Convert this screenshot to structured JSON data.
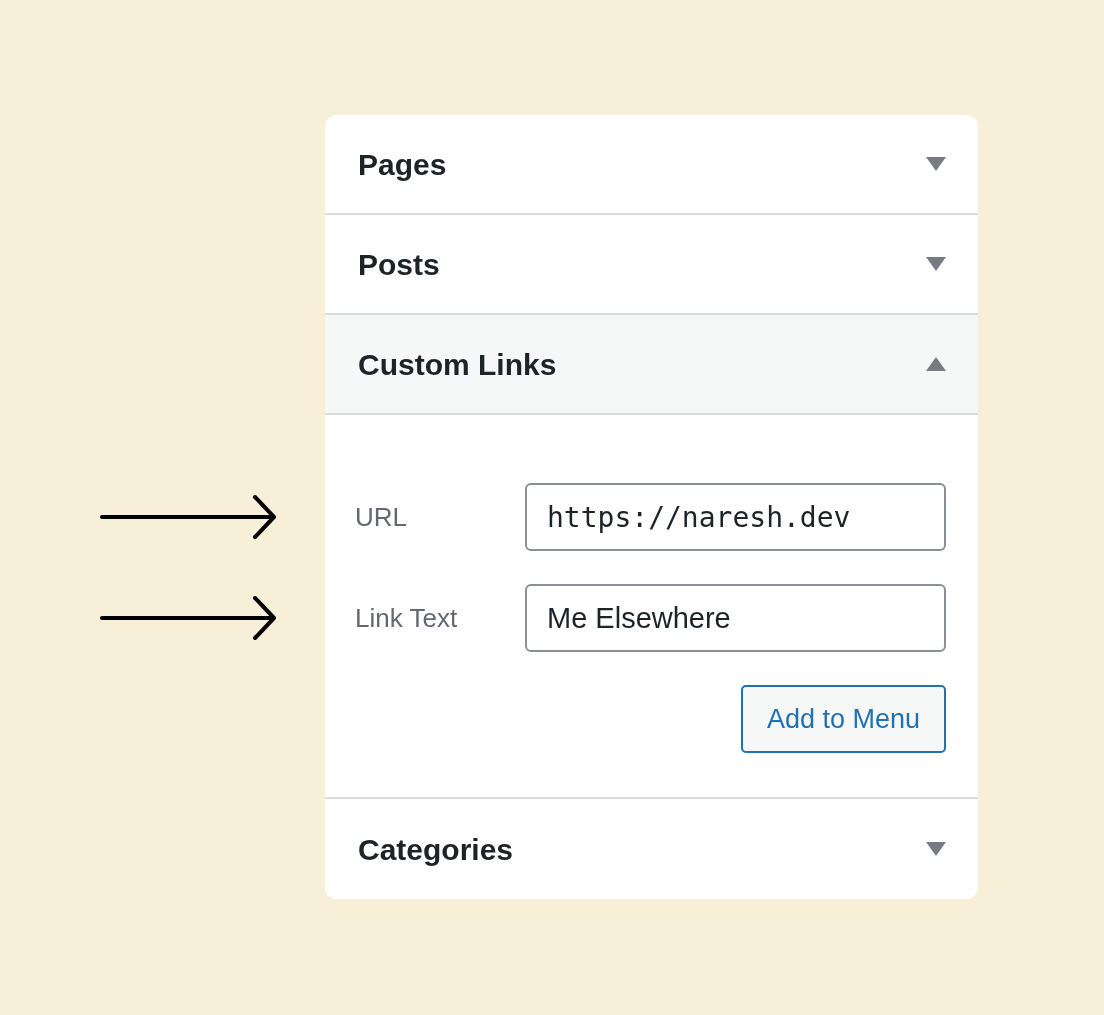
{
  "sections": [
    {
      "title": "Pages",
      "expanded": false
    },
    {
      "title": "Posts",
      "expanded": false
    },
    {
      "title": "Custom Links",
      "expanded": true,
      "fields": [
        {
          "label": "URL",
          "kind": "url",
          "value": "https://naresh.dev",
          "pointed": true
        },
        {
          "label": "Link Text",
          "kind": "text",
          "value": "Me Elsewhere",
          "pointed": true
        }
      ],
      "button": "Add to Menu"
    },
    {
      "title": "Categories",
      "expanded": false
    }
  ]
}
